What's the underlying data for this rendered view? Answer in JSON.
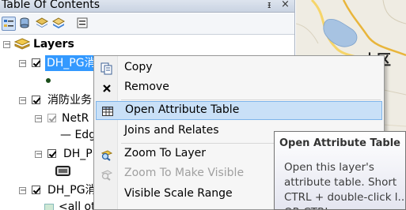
{
  "toc": {
    "title": "Table Of Contents",
    "pin_glyph": "ᵻ",
    "close_glyph": "×",
    "toolbar_icons": [
      "list-by-drawing-order-icon",
      "list-by-source-icon",
      "list-by-visibility-icon",
      "list-by-selection-icon",
      "options-icon"
    ],
    "tree": {
      "root_label": "Layers",
      "items": [
        {
          "label": "DH_PG消",
          "selected": true
        },
        {
          "label": "消防业务"
        },
        {
          "label": "NetR"
        },
        {
          "label": "— Edg"
        },
        {
          "label": "DH_P"
        },
        {
          "label": "DH_PG消"
        },
        {
          "label": "<all ot"
        }
      ]
    }
  },
  "map": {
    "label_fragment": "山区"
  },
  "context_menu": {
    "items": [
      {
        "label": "Copy",
        "icon": "copy-icon",
        "enabled": true,
        "highlighted": false
      },
      {
        "label": "Remove",
        "icon": "remove-icon",
        "enabled": true,
        "highlighted": false
      },
      {
        "label": "Open Attribute Table",
        "icon": "attribute-table-icon",
        "enabled": true,
        "highlighted": true
      },
      {
        "label": "Joins and Relates",
        "icon": "",
        "enabled": true,
        "highlighted": false
      },
      {
        "label": "Zoom To Layer",
        "icon": "zoom-to-layer-icon",
        "enabled": true,
        "highlighted": false
      },
      {
        "label": "Zoom To Make Visible",
        "icon": "zoom-to-make-visible-icon",
        "enabled": false,
        "highlighted": false
      },
      {
        "label": "Visible Scale Range",
        "icon": "",
        "enabled": true,
        "highlighted": false
      }
    ]
  },
  "tooltip": {
    "title": "Open Attribute Table",
    "body": "Open this layer's attribute table. Short CTRL + double-click l... OR CTRL"
  },
  "colors": {
    "selection": "#3399ff",
    "menu_highlight": "#c9e0f7",
    "menu_highlight_border": "#7eb4ea"
  }
}
